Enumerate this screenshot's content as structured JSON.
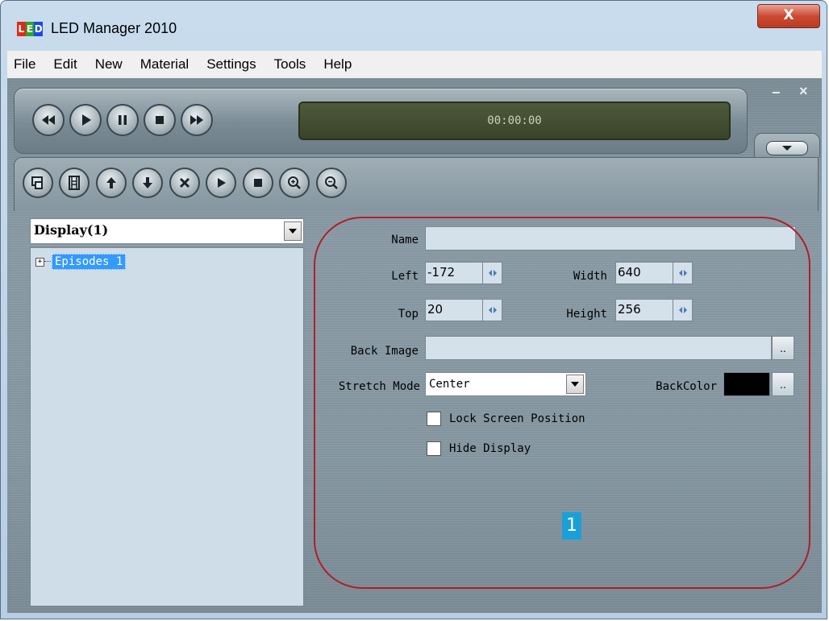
{
  "window": {
    "title": "LED Manager 2010",
    "icon": "led-app-icon",
    "icon_letters": [
      "L",
      "E",
      "D"
    ],
    "close_label": "X"
  },
  "menu": [
    "File",
    "Edit",
    "New",
    "Material",
    "Settings",
    "Tools",
    "Help"
  ],
  "player": {
    "time": "00:00:00",
    "buttons": [
      "rewind-icon",
      "play-icon",
      "pause-icon",
      "stop-icon",
      "fast-forward-icon"
    ],
    "minimize_label": "−",
    "close_label": "×"
  },
  "toolbar": {
    "buttons": [
      "display-icon",
      "film-icon",
      "move-up-icon",
      "move-down-icon",
      "delete-icon",
      "play-icon",
      "stop-icon",
      "zoom-in-icon",
      "zoom-out-icon"
    ]
  },
  "left_panel": {
    "selector_value": "Display(1)",
    "tree_expander": "+",
    "tree_items": [
      "Episodes 1"
    ]
  },
  "properties": {
    "name_label": "Name",
    "name_value": "",
    "left_label": "Left",
    "left_value": "-172",
    "width_label": "Width",
    "width_value": "640",
    "top_label": "Top",
    "top_value": "20",
    "height_label": "Height",
    "height_value": "256",
    "back_image_label": "Back Image",
    "back_image_value": "",
    "browse_label": "..",
    "stretch_mode_label": "Stretch Mode",
    "stretch_mode_value": "Center",
    "backcolor_label": "BackColor",
    "backcolor_value": "#000000",
    "lock_label": "Lock Screen Position",
    "lock_checked": false,
    "hide_label": "Hide Display",
    "hide_checked": false
  },
  "annotation": {
    "callout_number": "1",
    "ring_color": "#b01e2a",
    "callout_color": "#1a9fd8"
  }
}
